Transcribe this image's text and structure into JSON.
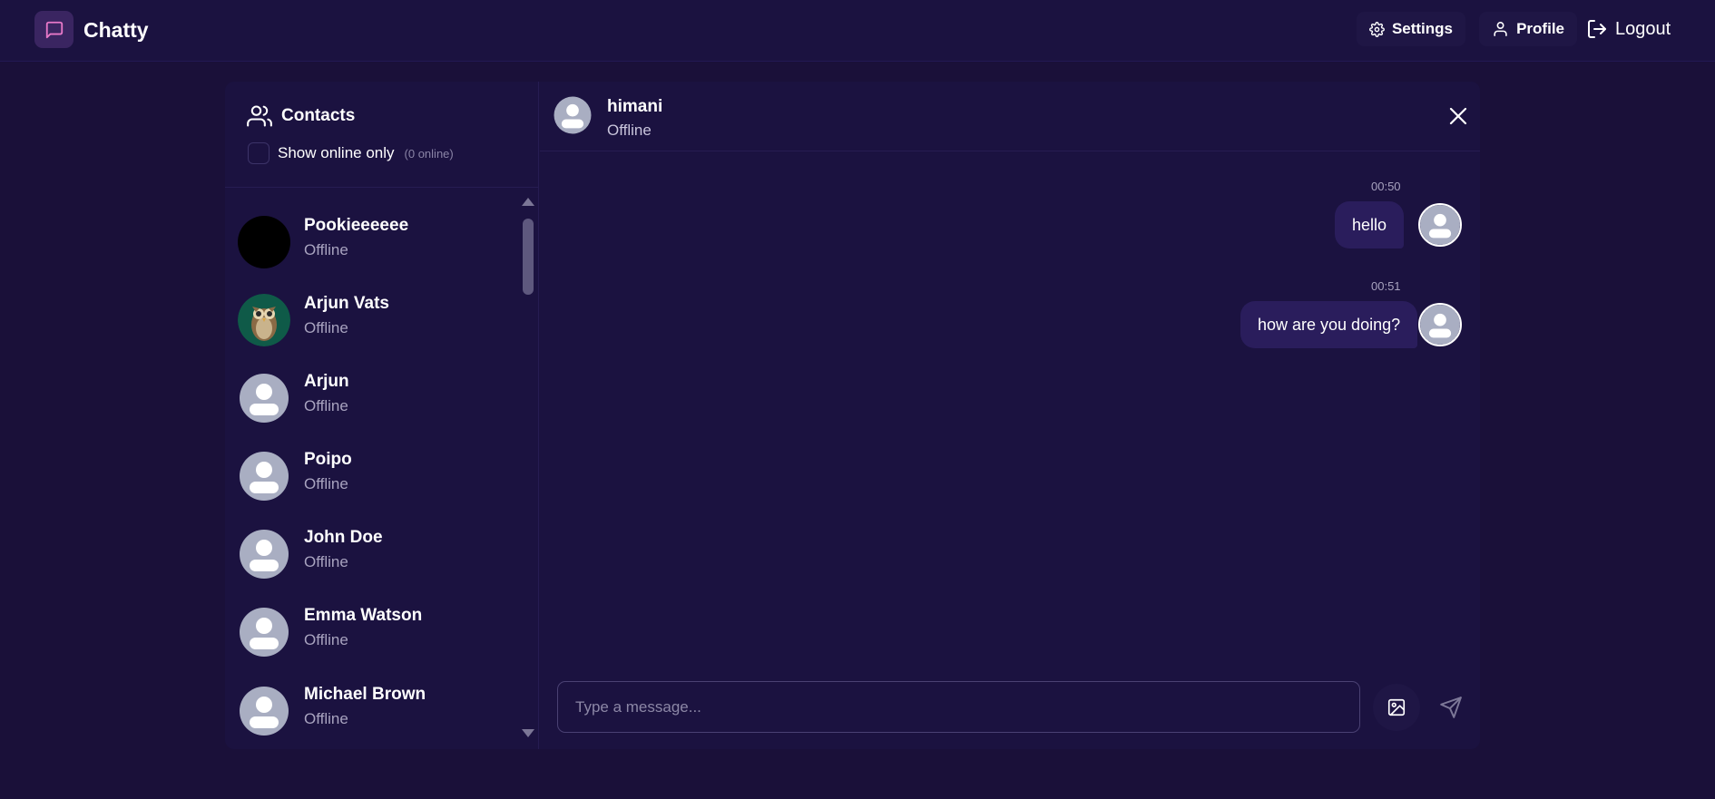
{
  "app": {
    "brand": "Chatty"
  },
  "nav": {
    "settings_label": "Settings",
    "profile_label": "Profile",
    "logout_label": "Logout"
  },
  "sidebar": {
    "title": "Contacts",
    "online_toggle_label": "Show online only",
    "online_count": "(0 online)",
    "contacts": [
      {
        "name": "Pookieeeeee",
        "status": "Offline",
        "avatar": "black-avatar"
      },
      {
        "name": "Arjun Vats",
        "status": "Offline",
        "avatar": "owl-avatar"
      },
      {
        "name": "Arjun",
        "status": "Offline",
        "avatar": "default-avatar"
      },
      {
        "name": "Poipo",
        "status": "Offline",
        "avatar": "default-avatar"
      },
      {
        "name": "John Doe",
        "status": "Offline",
        "avatar": "default-avatar"
      },
      {
        "name": "Emma Watson",
        "status": "Offline",
        "avatar": "default-avatar"
      },
      {
        "name": "Michael Brown",
        "status": "Offline",
        "avatar": "default-avatar"
      }
    ]
  },
  "chat": {
    "peer_name": "himani",
    "peer_status": "Offline",
    "messages": [
      {
        "time": "00:50",
        "text": "hello"
      },
      {
        "time": "00:51",
        "text": "how are you doing?"
      }
    ],
    "composer_placeholder": "Type a message..."
  },
  "colors": {
    "background": "#1a1039",
    "panel": "#1b1240",
    "bubble": "#2a1d5c",
    "logo_icon": "#e879c9"
  }
}
